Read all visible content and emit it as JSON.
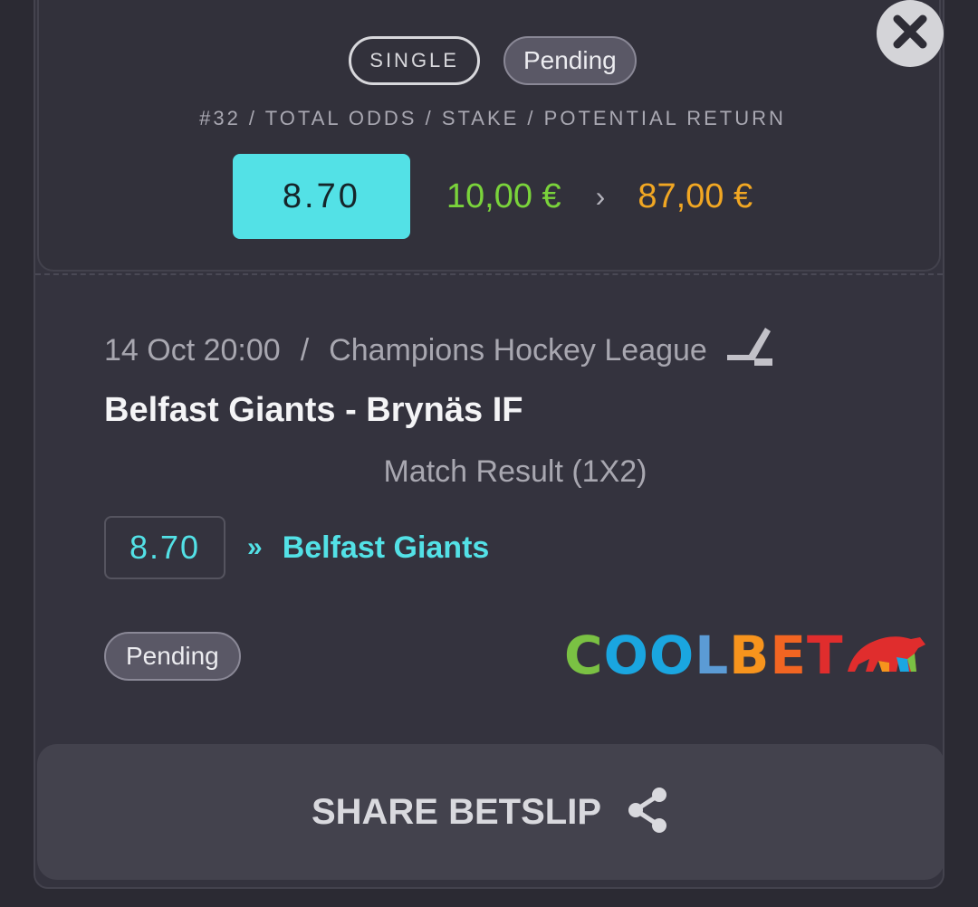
{
  "summary": {
    "bet_type": "SINGLE",
    "status": "Pending",
    "caption": "#32 / TOTAL ODDS / STAKE / POTENTIAL RETURN",
    "total_odds": "8.70",
    "stake": "10,00 €",
    "separator": "›",
    "potential_return": "87,00 €"
  },
  "event": {
    "datetime": "14 Oct 20:00",
    "slash": "/",
    "competition": "Champions Hockey League",
    "sport_icon": "ice-hockey-stick-icon",
    "match": "Belfast Giants - Brynäs IF",
    "market": "Match Result (1X2)",
    "pick_odds": "8.70",
    "pick_arrow": "»",
    "pick": "Belfast Giants",
    "status": "Pending"
  },
  "bookmaker": {
    "logo_text": "COOLBET",
    "letter_colors": [
      "#7ac143",
      "#1aa6e0",
      "#1aa6e0",
      "#5b9bd5",
      "#f7941d",
      "#f26522",
      "#e02d2d"
    ]
  },
  "share": {
    "label": "SHARE BETSLIP",
    "icon": "share-icon"
  },
  "colors": {
    "accent": "#53e1e6",
    "stake": "#7ad33b",
    "return": "#f1a723",
    "background": "#2b2a33"
  }
}
